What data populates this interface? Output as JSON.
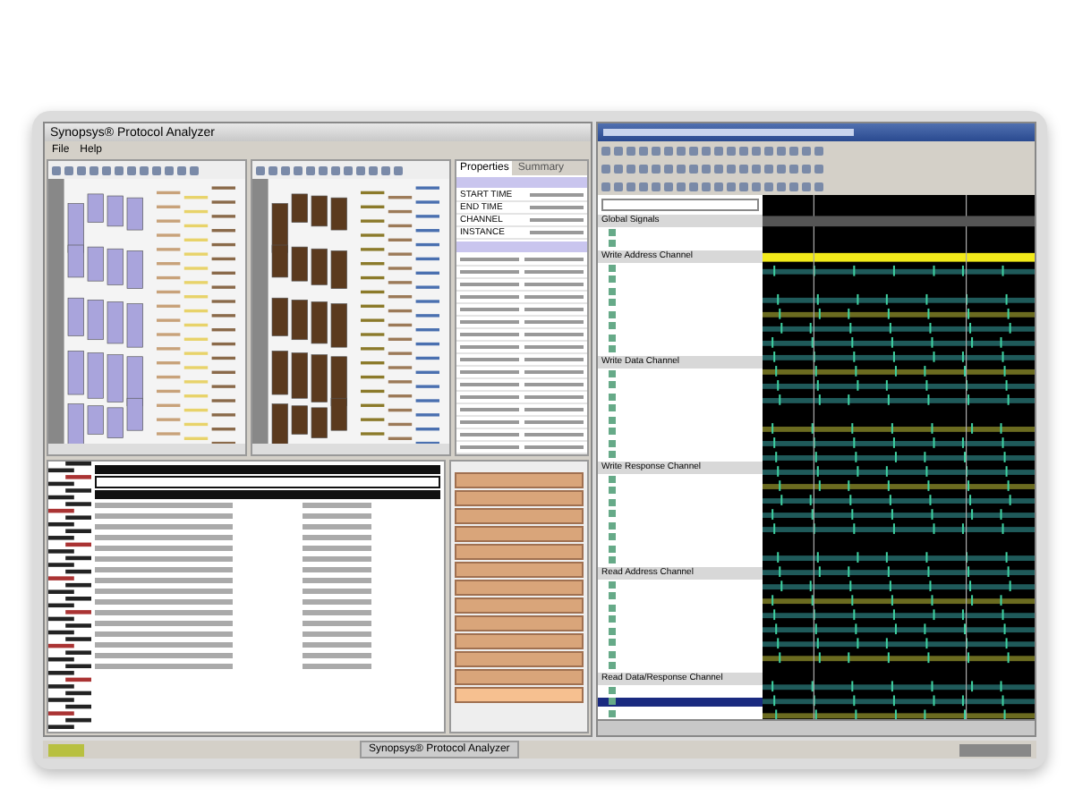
{
  "analyzer": {
    "title": "Synopsys® Protocol Analyzer",
    "menu": [
      "File",
      "Help"
    ],
    "properties": {
      "tabs": [
        {
          "label": "Properties",
          "selected": true
        },
        {
          "label": "Summary",
          "selected": false
        }
      ],
      "fields": [
        "START TIME",
        "END TIME",
        "CHANNEL",
        "INSTANCE"
      ]
    },
    "transactions": [
      {
        "selected": false
      },
      {
        "selected": false
      },
      {
        "selected": false
      },
      {
        "selected": false
      },
      {
        "selected": false
      },
      {
        "selected": false
      },
      {
        "selected": false
      },
      {
        "selected": false
      },
      {
        "selected": false
      },
      {
        "selected": false
      },
      {
        "selected": false
      },
      {
        "selected": false
      },
      {
        "selected": true
      }
    ]
  },
  "waveform": {
    "groups": [
      {
        "name": "Global Signals",
        "signals": [
          {
            "selected": false
          },
          {
            "selected": false
          }
        ]
      },
      {
        "name": "Write Address Channel",
        "signals": [
          {
            "selected": false
          },
          {
            "selected": false
          },
          {
            "selected": false
          },
          {
            "selected": false
          },
          {
            "selected": false
          },
          {
            "selected": false
          },
          {
            "selected": false
          },
          {
            "selected": false
          }
        ]
      },
      {
        "name": "Write Data Channel",
        "signals": [
          {
            "selected": false
          },
          {
            "selected": false
          },
          {
            "selected": false
          },
          {
            "selected": false
          },
          {
            "selected": false
          },
          {
            "selected": false
          },
          {
            "selected": false
          },
          {
            "selected": false
          }
        ]
      },
      {
        "name": "Write Response Channel",
        "signals": [
          {
            "selected": false
          },
          {
            "selected": false
          },
          {
            "selected": false
          },
          {
            "selected": false
          },
          {
            "selected": false
          },
          {
            "selected": false
          },
          {
            "selected": false
          },
          {
            "selected": false
          }
        ]
      },
      {
        "name": "Read Address Channel",
        "signals": [
          {
            "selected": false
          },
          {
            "selected": false
          },
          {
            "selected": false
          },
          {
            "selected": false
          },
          {
            "selected": false
          },
          {
            "selected": false
          },
          {
            "selected": false
          },
          {
            "selected": false
          }
        ]
      },
      {
        "name": "Read Data/Response Channel",
        "signals": [
          {
            "selected": false
          },
          {
            "selected": true
          },
          {
            "selected": false
          }
        ]
      }
    ]
  },
  "taskbar": {
    "items": [
      "Synopsys® Protocol Analyzer"
    ]
  }
}
